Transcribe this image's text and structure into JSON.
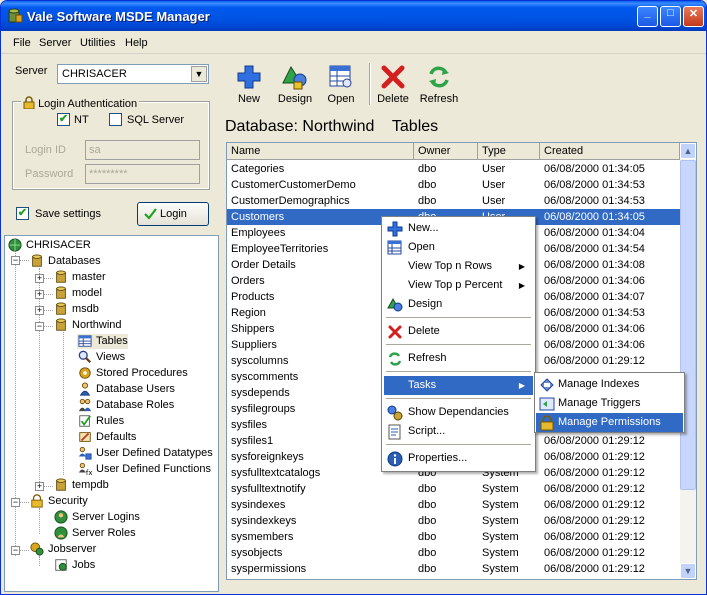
{
  "window": {
    "title": "Vale Software MSDE Manager",
    "min_glyph": "_",
    "max_glyph": "□",
    "close_glyph": "✕"
  },
  "menu": [
    "File",
    "Server",
    "Utilities",
    "Help"
  ],
  "server": {
    "label": "Server",
    "value": "CHRISACER"
  },
  "login": {
    "group_title": "Login Authentication",
    "nt_label": "NT",
    "nt_checked": true,
    "sql_label": "SQL Server",
    "sql_checked": false,
    "login_id_label": "Login ID",
    "login_id_value": "sa",
    "password_label": "Password",
    "password_value": "*********",
    "save_label": "Save settings",
    "save_checked": true,
    "login_button": "Login"
  },
  "toolbar": {
    "new": "New",
    "design": "Design",
    "open": "Open",
    "delete": "Delete",
    "refresh": "Refresh"
  },
  "heading": "Database: Northwind    Tables",
  "tree": {
    "server": "CHRISACER",
    "databases": "Databases",
    "master": "master",
    "model": "model",
    "msdb": "msdb",
    "northwind": "Northwind",
    "tables": "Tables",
    "views": "Views",
    "stored_procedures": "Stored Procedures",
    "database_users": "Database Users",
    "database_roles": "Database Roles",
    "rules": "Rules",
    "defaults": "Defaults",
    "user_defined_datatypes": "User Defined Datatypes",
    "user_defined_functions": "User Defined Functions",
    "tempdb": "tempdb",
    "security": "Security",
    "server_logins": "Server Logins",
    "server_roles": "Server Roles",
    "jobserver": "Jobserver",
    "jobs": "Jobs"
  },
  "grid": {
    "columns": [
      "Name",
      "Owner",
      "Type",
      "Created"
    ],
    "rows": [
      [
        "Categories",
        "dbo",
        "User",
        "06/08/2000 01:34:05"
      ],
      [
        "CustomerCustomerDemo",
        "dbo",
        "User",
        "06/08/2000 01:34:53"
      ],
      [
        "CustomerDemographics",
        "dbo",
        "User",
        "06/08/2000 01:34:53"
      ],
      [
        "Customers",
        "dbo",
        "User",
        "06/08/2000 01:34:05"
      ],
      [
        "Employees",
        "",
        "",
        "06/08/2000 01:34:04"
      ],
      [
        "EmployeeTerritories",
        "",
        "",
        "06/08/2000 01:34:54"
      ],
      [
        "Order Details",
        "",
        "",
        "06/08/2000 01:34:08"
      ],
      [
        "Orders",
        "",
        "",
        "06/08/2000 01:34:06"
      ],
      [
        "Products",
        "",
        "",
        "06/08/2000 01:34:07"
      ],
      [
        "Region",
        "",
        "",
        "06/08/2000 01:34:53"
      ],
      [
        "Shippers",
        "",
        "",
        "06/08/2000 01:34:06"
      ],
      [
        "Suppliers",
        "",
        "",
        "06/08/2000 01:34:06"
      ],
      [
        "syscolumns",
        "",
        "",
        "06/08/2000 01:29:12"
      ],
      [
        "syscomments",
        "",
        "",
        ""
      ],
      [
        "sysdepends",
        "",
        "",
        ""
      ],
      [
        "sysfilegroups",
        "",
        "",
        ""
      ],
      [
        "sysfiles",
        "",
        "",
        ""
      ],
      [
        "sysfiles1",
        "",
        "",
        "06/08/2000 01:29:12"
      ],
      [
        "sysforeignkeys",
        "",
        "",
        "06/08/2000 01:29:12"
      ],
      [
        "sysfulltextcatalogs",
        "dbo",
        "System",
        "06/08/2000 01:29:12"
      ],
      [
        "sysfulltextnotify",
        "dbo",
        "System",
        "06/08/2000 01:29:12"
      ],
      [
        "sysindexes",
        "dbo",
        "System",
        "06/08/2000 01:29:12"
      ],
      [
        "sysindexkeys",
        "dbo",
        "System",
        "06/08/2000 01:29:12"
      ],
      [
        "sysmembers",
        "dbo",
        "System",
        "06/08/2000 01:29:12"
      ],
      [
        "sysobjects",
        "dbo",
        "System",
        "06/08/2000 01:29:12"
      ],
      [
        "syspermissions",
        "dbo",
        "System",
        "06/08/2000 01:29:12"
      ]
    ]
  },
  "context_menu": {
    "new": "New...",
    "open": "Open",
    "view_top_n": "View Top n Rows",
    "view_top_p": "View Top p Percent",
    "design": "Design",
    "delete": "Delete",
    "refresh": "Refresh",
    "tasks": "Tasks",
    "show_dependancies": "Show Dependancies",
    "script": "Script...",
    "properties": "Properties..."
  },
  "tasks_submenu": {
    "manage_indexes": "Manage Indexes",
    "manage_triggers": "Manage Triggers",
    "manage_permissions": "Manage Permissions"
  },
  "colors": {
    "titlebar": "#0054e3",
    "selection": "#316ac5",
    "face": "#ece9d8"
  }
}
